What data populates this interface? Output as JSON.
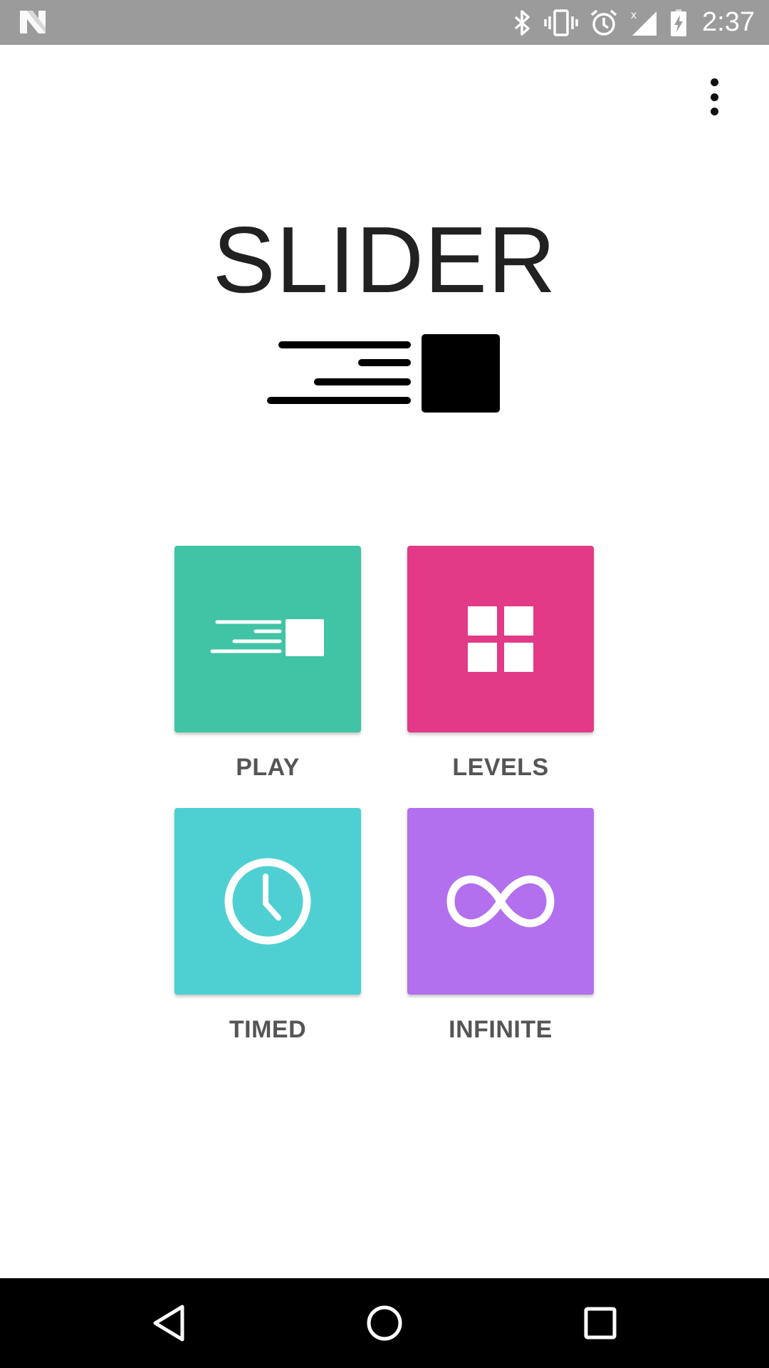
{
  "status_bar": {
    "time": "2:37",
    "icons": [
      "notification-n-icon",
      "bluetooth-icon",
      "vibrate-icon",
      "alarm-icon",
      "signal-icon",
      "battery-charging-icon"
    ]
  },
  "app": {
    "title": "SLIDER",
    "logo_icon": "slider-logo-icon"
  },
  "menu": {
    "overflow_icon": "more-vert-icon"
  },
  "tiles": [
    {
      "id": "play",
      "label": "PLAY",
      "color": "#41c3a5",
      "icon": "slider-logo-icon"
    },
    {
      "id": "levels",
      "label": "LEVELS",
      "color": "#e23a86",
      "icon": "grid-icon"
    },
    {
      "id": "timed",
      "label": "TIMED",
      "color": "#4ed0d3",
      "icon": "clock-icon"
    },
    {
      "id": "infinite",
      "label": "INFINITE",
      "color": "#b26fee",
      "icon": "infinity-icon"
    }
  ],
  "nav_bar": {
    "buttons": [
      "back-icon",
      "home-icon",
      "recents-icon"
    ]
  },
  "colors": {
    "status_bar": "#9b9b9b",
    "title": "#212121",
    "label": "#555555",
    "nav_bar": "#000000"
  }
}
